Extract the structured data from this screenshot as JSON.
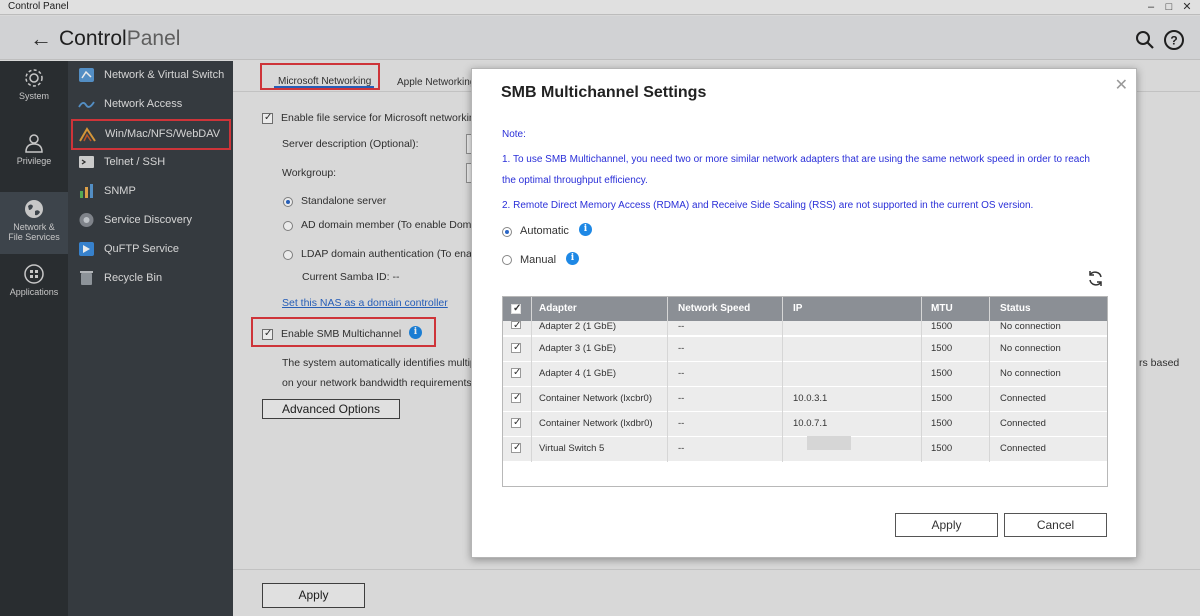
{
  "window": {
    "title": "Control Panel"
  },
  "header": {
    "title_main": "Control",
    "title_light": "Panel"
  },
  "rail": {
    "items": [
      {
        "label": "System"
      },
      {
        "label": "Privilege"
      },
      {
        "label_line1": "Network &",
        "label_line2": "File Services"
      },
      {
        "label": "Applications"
      }
    ]
  },
  "subnav": {
    "items": [
      {
        "label": "Network & Virtual Switch"
      },
      {
        "label": "Network Access"
      },
      {
        "label": "Win/Mac/NFS/WebDAV"
      },
      {
        "label": "Telnet / SSH"
      },
      {
        "label": "SNMP"
      },
      {
        "label": "Service Discovery"
      },
      {
        "label": "QuFTP Service"
      },
      {
        "label": "Recycle Bin"
      }
    ]
  },
  "main": {
    "tabs": [
      {
        "label": "Microsoft Networking"
      },
      {
        "label": "Apple Networking"
      }
    ],
    "enable_file_service": "Enable file service for Microsoft networking",
    "server_description": "Server description (Optional):",
    "workgroup": "Workgroup:",
    "standalone": "Standalone server",
    "ad_member": "AD domain member (To enable Domai",
    "ldap_auth": "LDAP domain authentication (To enab",
    "samba_id": "Current Samba ID: --",
    "domain_controller_link": "Set this NAS as a domain controller",
    "enable_smb": "Enable SMB Multichannel",
    "desc_line1": "The system automatically identifies multip",
    "desc_line1_tail": "rs based",
    "desc_line2": "on your network bandwidth requirements,",
    "advanced_options": "Advanced Options",
    "apply": "Apply"
  },
  "modal": {
    "title": "SMB Multichannel Settings",
    "note_label": "Note:",
    "note1_line1": "1. To use SMB Multichannel, you need two or more similar network adapters that are using the same network speed in order to reach",
    "note1_line2": "the optimal throughput efficiency.",
    "note2": "2. Remote Direct Memory Access (RDMA) and Receive Side Scaling (RSS) are not supported in the current OS version.",
    "automatic": "Automatic",
    "manual": "Manual",
    "columns": [
      "Adapter",
      "Network Speed",
      "IP",
      "MTU",
      "Status"
    ],
    "rows": [
      {
        "adapter": "Adapter 2 (1 GbE)",
        "speed": "--",
        "ip": "",
        "mtu": "1500",
        "status": "No connection"
      },
      {
        "adapter": "Adapter 3 (1 GbE)",
        "speed": "--",
        "ip": "",
        "mtu": "1500",
        "status": "No connection"
      },
      {
        "adapter": "Adapter 4 (1 GbE)",
        "speed": "--",
        "ip": "",
        "mtu": "1500",
        "status": "No connection"
      },
      {
        "adapter": "Container Network (lxcbr0)",
        "speed": "--",
        "ip": "10.0.3.1",
        "mtu": "1500",
        "status": "Connected"
      },
      {
        "adapter": "Container Network (lxdbr0)",
        "speed": "--",
        "ip": "10.0.7.1",
        "mtu": "1500",
        "status": "Connected"
      },
      {
        "adapter": "Virtual Switch 5",
        "speed": "--",
        "ip": "",
        "mtu": "1500",
        "status": "Connected"
      }
    ],
    "apply": "Apply",
    "cancel": "Cancel"
  }
}
